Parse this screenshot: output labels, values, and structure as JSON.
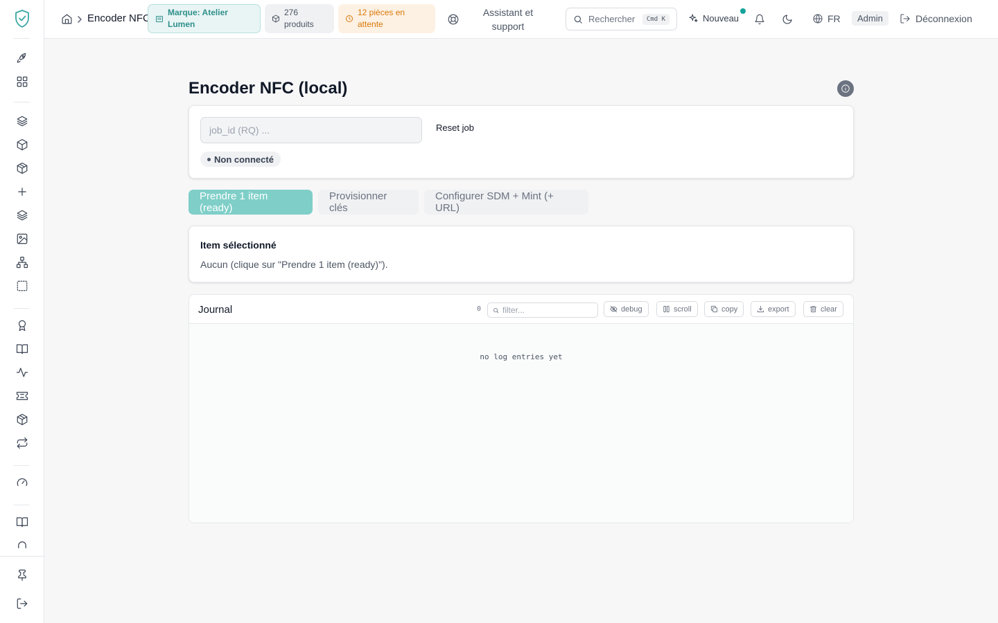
{
  "header": {
    "breadcrumb_title": "Encoder NFC",
    "brand_chip": "Marque: Atelier Lumen",
    "products_chip": "276 produits",
    "waiting_chip": "12 pièces en attente",
    "assistant_label": "Assistant et support",
    "search_label": "Rechercher",
    "search_shortcut": "Cmd K",
    "new_label": "Nouveau",
    "lang_label": "FR",
    "role_badge": "Admin",
    "logout_label": "Déconnexion"
  },
  "page": {
    "title": "Encoder NFC (local)"
  },
  "job": {
    "input_placeholder": "job_id (RQ) ...",
    "input_value": "",
    "reset_label": "Reset job",
    "status": "Non connecté"
  },
  "tabs": [
    {
      "label": "Prendre 1 item (ready)",
      "active": true
    },
    {
      "label": "Provisionner clés",
      "active": false
    },
    {
      "label": "Configurer SDM + Mint (+ URL)",
      "active": false
    }
  ],
  "selected_item": {
    "title": "Item sélectionné",
    "description": "Aucun (clique sur \"Prendre 1 item (ready)\")."
  },
  "journal": {
    "title": "Journal",
    "count": "0",
    "filter_placeholder": "filter...",
    "buttons": {
      "debug": "debug",
      "scroll": "scroll",
      "copy": "copy",
      "export": "export",
      "clear": "clear"
    },
    "empty_text": "no log entries yet"
  },
  "colors": {
    "accent": "#7fcfc8",
    "brand_teal": "#2f8f8b",
    "warning": "#d97706",
    "notification_dot": "#14a39a"
  },
  "icons": {
    "sidebar": [
      "rocket-icon",
      "dashboard-icon",
      "layers-icon",
      "box-icon",
      "package-icon",
      "plus-icon",
      "layers-icon",
      "image-icon",
      "sitemap-icon",
      "selection-icon",
      "award-icon",
      "book-open-icon",
      "activity-icon",
      "ticket-icon",
      "package-icon",
      "repeat-icon",
      "gauge-icon",
      "book-open-icon",
      "arch-icon",
      "pin-icon",
      "logout-icon"
    ]
  }
}
